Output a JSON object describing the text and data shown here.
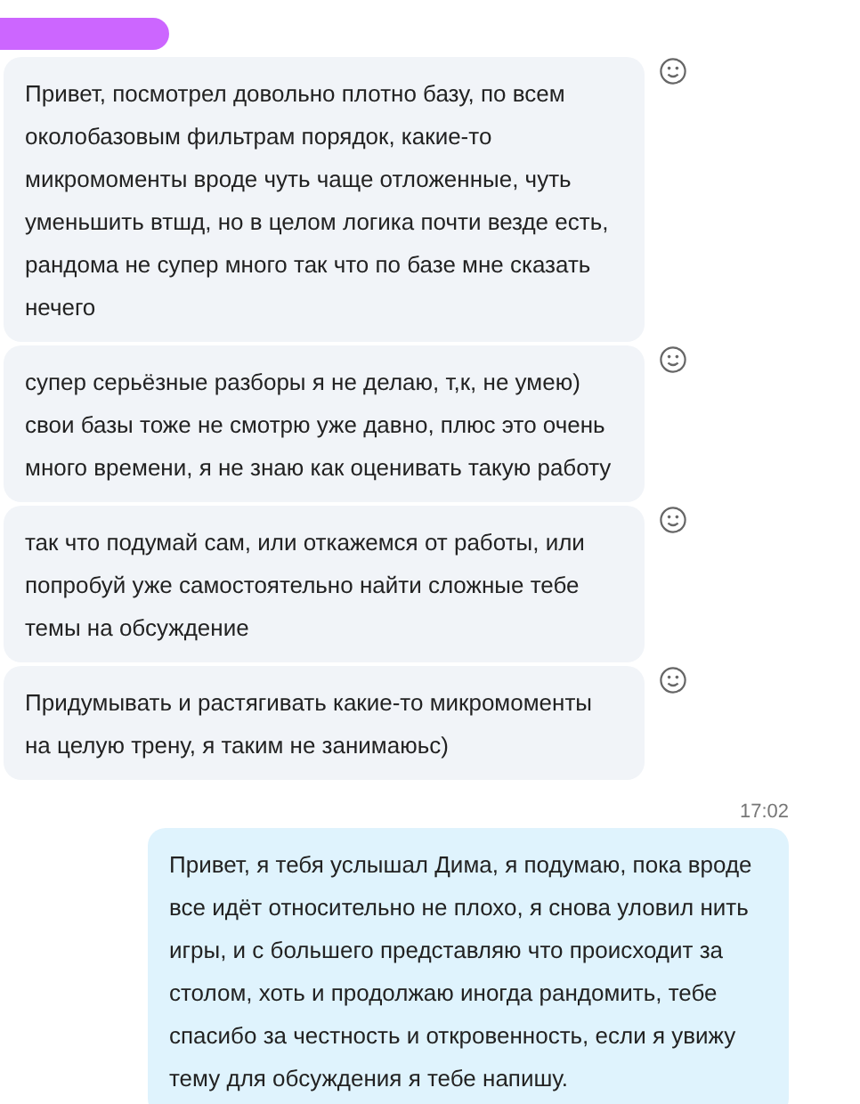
{
  "incoming_messages": [
    {
      "text": "Привет, посмотрел довольно плотно базу, по всем околобазовым фильтрам порядок, какие-то микромоменты вроде чуть чаще отложенные, чуть уменьшить втшд, но в целом логика почти везде есть, рандома не супер много так что по базе мне сказать нечего"
    },
    {
      "text": "супер серьёзные разборы я не делаю, т,к, не умею) свои базы тоже не смотрю уже давно, плюс это очень много времени, я не знаю как оценивать такую работу"
    },
    {
      "text": "так что подумай сам, или откажемся от работы, или попробуй уже самостоятельно найти сложные тебе темы на обсуждение"
    },
    {
      "text": "Придумывать и растягивать какие-то микромоменты на целую трену, я таким не занимаюьс)"
    }
  ],
  "outgoing_message": {
    "time": "17:02",
    "text": "Привет, я тебя услышал Дима, я подумаю, пока вроде все идёт относительно не плохо, я снова уловил нить игры, и с большего представляю что происходит за столом, хоть и продолжаю иногда рандомить, тебе спасибо за честность и откровенность, если я увижу тему для обсуждения я тебе напишу."
  }
}
